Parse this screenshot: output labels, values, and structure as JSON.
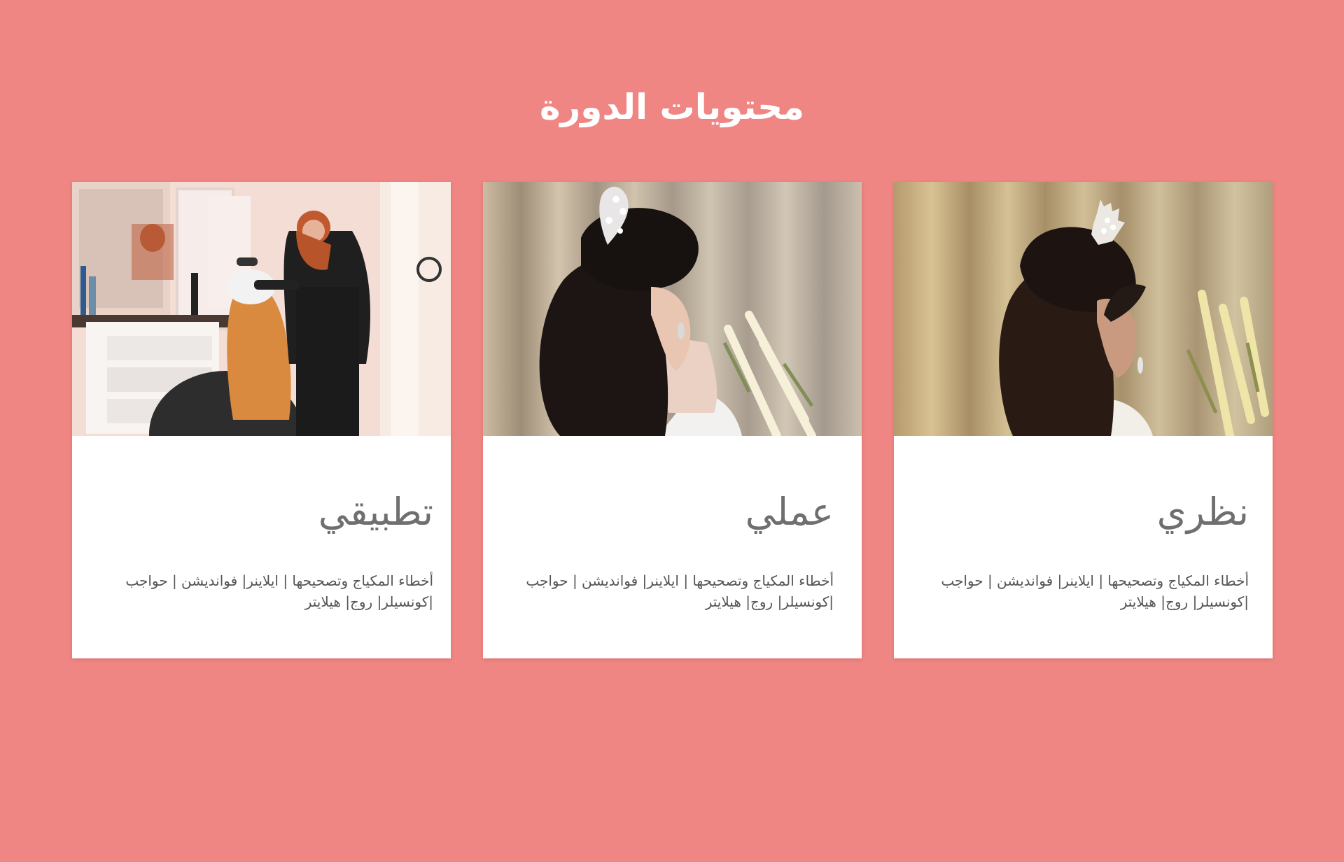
{
  "section": {
    "title": "محتويات الدورة"
  },
  "cards": [
    {
      "title": "تطبيقي",
      "description": "أخطاء المكياج وتصحيحها | ايلاينر| فواندیشن | حواجب |كونسيلر| روج| هيلايتر",
      "image": "hair-coloring-photo"
    },
    {
      "title": "عملي",
      "description": "أخطاء المكياج وتصحيحها | ايلاينر| فواندیشن | حواجب |كونسيلر| روج| هيلايتر",
      "image": "bridal-hairstyle-photo"
    },
    {
      "title": "نظري",
      "description": "أخطاء المكياج وتصحيحها | ايلاينر| فواندیشن | حواجب |كونسيلر| روج| هيلايتر",
      "image": "bridal-updo-photo"
    }
  ],
  "colors": {
    "background": "#f08683",
    "card": "#ffffff",
    "title": "#ffffff",
    "card_title": "#6f6f6f",
    "card_text": "#555555"
  }
}
